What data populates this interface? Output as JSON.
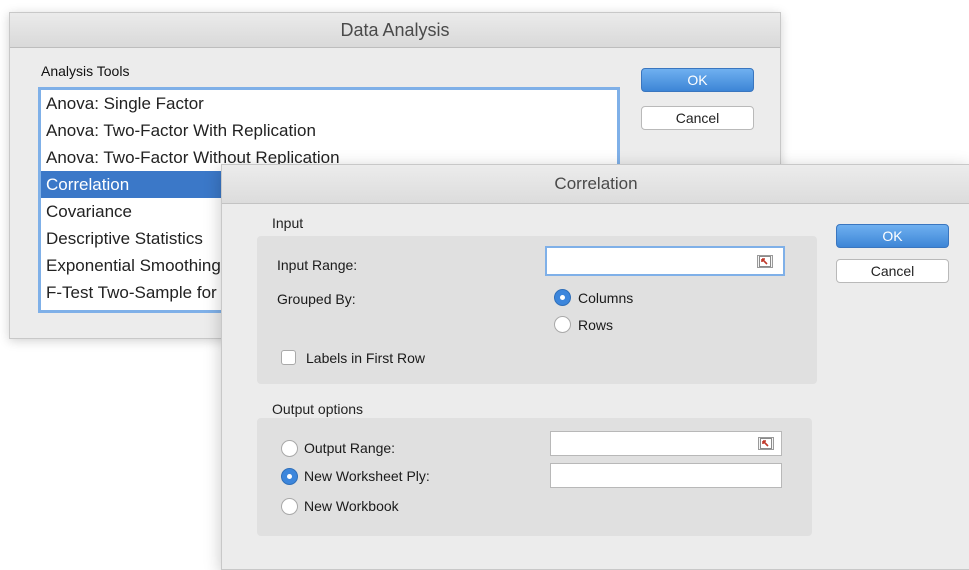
{
  "data_analysis": {
    "title": "Data Analysis",
    "tools_label": "Analysis Tools",
    "items": [
      {
        "label": "Anova: Single Factor",
        "selected": false
      },
      {
        "label": "Anova: Two-Factor With Replication",
        "selected": false
      },
      {
        "label": "Anova: Two-Factor Without Replication",
        "selected": false
      },
      {
        "label": "Correlation",
        "selected": true
      },
      {
        "label": "Covariance",
        "selected": false
      },
      {
        "label": "Descriptive Statistics",
        "selected": false
      },
      {
        "label": "Exponential Smoothing",
        "selected": false
      },
      {
        "label": "F-Test Two-Sample for Variances",
        "selected": false
      }
    ],
    "ok_label": "OK",
    "cancel_label": "Cancel"
  },
  "correlation": {
    "title": "Correlation",
    "ok_label": "OK",
    "cancel_label": "Cancel",
    "input": {
      "section_label": "Input",
      "input_range_label": "Input Range:",
      "input_range_value": "",
      "grouped_by_label": "Grouped By:",
      "grouped_by_options": [
        "Columns",
        "Rows"
      ],
      "grouped_by_selected": "Columns",
      "labels_first_row_label": "Labels in First Row",
      "labels_first_row_checked": false
    },
    "output": {
      "section_label": "Output options",
      "output_range_label": "Output Range:",
      "output_range_value": "",
      "new_worksheet_label": "New Worksheet Ply:",
      "new_worksheet_value": "",
      "new_workbook_label": "New Workbook",
      "selected": "New Worksheet Ply:"
    }
  },
  "colors": {
    "accent": "#3c86dc",
    "selection": "#3b78c8",
    "focus_ring": "#7fb0e8"
  },
  "icons": {
    "collapse_dialog": "collapse-dialog-icon"
  }
}
